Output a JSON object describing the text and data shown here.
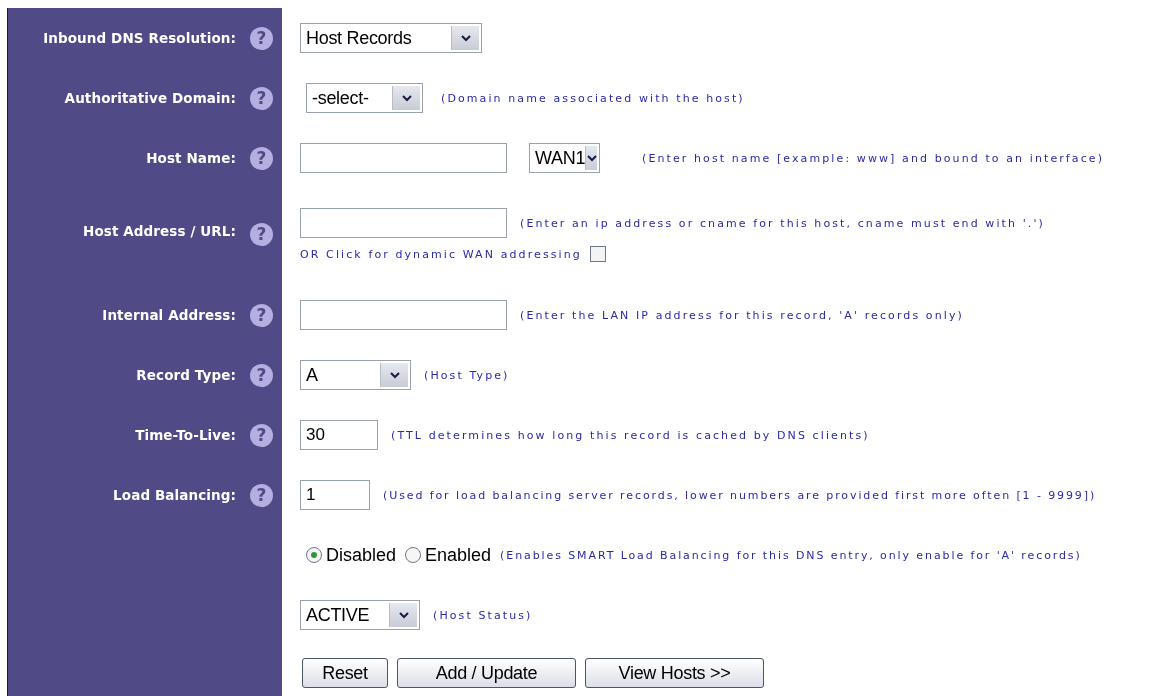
{
  "rows": [
    {
      "label": "Inbound DNS Resolution:",
      "help": "?",
      "controls": [
        {
          "kind": "select",
          "value": "Host Records"
        }
      ]
    },
    {
      "label": "Authoritative Domain:",
      "help": "?",
      "controls": [
        {
          "kind": "select",
          "value": "-select-"
        },
        {
          "kind": "hint",
          "text": "(Domain name associated with the host)"
        }
      ]
    },
    {
      "label": "Host Name:",
      "help": "?",
      "controls": [
        {
          "kind": "input"
        },
        {
          "kind": "select",
          "value": "WAN1"
        },
        {
          "kind": "hint",
          "text": "(Enter host name [example: www] and bound to an interface)"
        }
      ]
    },
    {
      "label": "Host Address / URL:",
      "help": "?",
      "controls": [
        {
          "kind": "input"
        },
        {
          "kind": "hint",
          "text": "(Enter an ip address or cname for this host, cname must end with '.')"
        }
      ],
      "extra": {
        "text": "OR Click for dynamic WAN addressing",
        "checked": false
      }
    },
    {
      "label": "Internal Address:",
      "help": "?",
      "controls": [
        {
          "kind": "input"
        },
        {
          "kind": "hint",
          "text": "(Enter the LAN IP address for this record, 'A' records only)"
        }
      ]
    },
    {
      "label": "Record Type:",
      "help": "?",
      "controls": [
        {
          "kind": "select",
          "value": "A"
        },
        {
          "kind": "hint",
          "text": "(Host Type)"
        }
      ]
    },
    {
      "label": "Time-To-Live:",
      "help": "?",
      "controls": [
        {
          "kind": "input",
          "value": "30"
        },
        {
          "kind": "hint",
          "text": "(TTL determines how long this record is cached by DNS clients)"
        }
      ]
    },
    {
      "label": "Load Balancing:",
      "help": "?",
      "controls": [
        {
          "kind": "input",
          "value": "1"
        },
        {
          "kind": "hint",
          "text": "(Used for load balancing server records, lower numbers are provided first more often [1 - 9999])"
        }
      ]
    },
    {
      "controls": [
        {
          "kind": "radio",
          "text": "Disabled",
          "selected": true
        },
        {
          "kind": "radio",
          "text": "Enabled",
          "selected": false
        },
        {
          "kind": "hint",
          "text": "(Enables SMART Load Balancing for this DNS entry, only enable for 'A' records)"
        }
      ]
    },
    {
      "controls": [
        {
          "kind": "select",
          "value": "ACTIVE"
        },
        {
          "kind": "hint",
          "text": "(Host Status)"
        }
      ]
    },
    {
      "controls": [
        {
          "kind": "button",
          "text": "Reset"
        },
        {
          "kind": "button",
          "text": "Add / Update"
        },
        {
          "kind": "button",
          "text": "View Hosts >>"
        }
      ]
    }
  ]
}
